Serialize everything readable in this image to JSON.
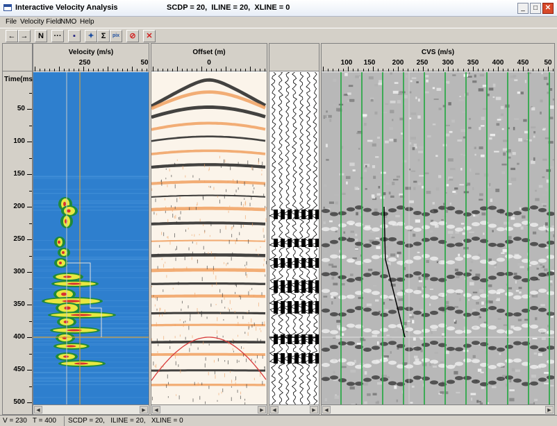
{
  "window": {
    "title": "Interactive Velocity Analysis",
    "info": "SCDP = 20,  ILINE = 20,  XLINE = 0",
    "minimize": "_",
    "maximize": "□",
    "close": "✕"
  },
  "menu": [
    "File",
    "Velocity Field",
    "NMO",
    "Help"
  ],
  "toolbar": [
    {
      "name": "prev-button",
      "label": "←"
    },
    {
      "name": "next-button",
      "label": "→"
    },
    {
      "name": "n-button",
      "label": "N"
    },
    {
      "name": "dots-button",
      "label": "···"
    },
    {
      "name": "save-button",
      "label": "▪"
    },
    {
      "name": "pick-button",
      "label": "✦"
    },
    {
      "name": "sum-button",
      "label": "Σ"
    },
    {
      "name": "pix-button",
      "label": "pix"
    },
    {
      "name": "stop-button",
      "label": "⊘"
    },
    {
      "name": "delete-button",
      "label": "✕"
    }
  ],
  "time_axis": {
    "label": "Time(ms)",
    "ticks": [
      "50",
      "100",
      "150",
      "200",
      "250",
      "300",
      "350",
      "400",
      "450",
      "500"
    ],
    "values": [
      50,
      100,
      150,
      200,
      250,
      300,
      350,
      400,
      450,
      500
    ]
  },
  "panels": {
    "semblance": {
      "title": "Velocity (m/s)",
      "tick_labels": [
        "250",
        "50"
      ]
    },
    "gather": {
      "title": "Offset (m)",
      "tick_labels": [
        "0"
      ]
    },
    "trace": {
      "title": ""
    },
    "cvs": {
      "title": "CVS (m/s)",
      "tick_labels": [
        "100",
        "150",
        "200",
        "250",
        "300",
        "350",
        "400",
        "450",
        "50"
      ]
    }
  },
  "colors": {
    "semblance_bg": "#2e7fce",
    "cvs_line": "#2fa84a",
    "pick_line": "#000000",
    "hyperbola": "#d83a3a",
    "orange": "#f0a060"
  },
  "picks": [
    {
      "time": 200,
      "velocity": 180
    },
    {
      "time": 280,
      "velocity": 183
    },
    {
      "time": 400,
      "velocity": 230
    }
  ],
  "status": {
    "cursor": "V = 230   T = 400",
    "location": "SCDP = 20,   ILINE = 20,   XLINE = 0"
  }
}
